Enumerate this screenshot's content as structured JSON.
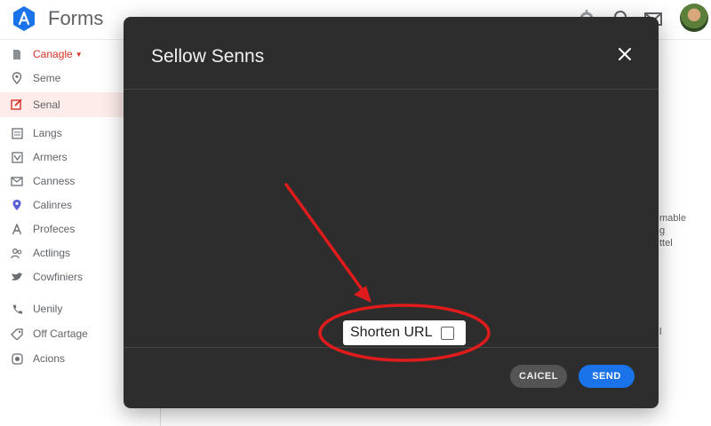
{
  "app": {
    "title": "Forms"
  },
  "header_icons": [
    "settings-icon",
    "search-icon",
    "mail-icon"
  ],
  "sidebar": {
    "items": [
      {
        "label": "Canagle",
        "icon": "document-icon"
      },
      {
        "label": "Seme",
        "icon": "location-pin-icon"
      },
      {
        "label": "Senal",
        "icon": "edit-icon"
      },
      {
        "label": "Langs",
        "icon": "list-icon"
      },
      {
        "label": "Armers",
        "icon": "image-icon"
      },
      {
        "label": "Canness",
        "icon": "mail-icon"
      },
      {
        "label": "Calinres",
        "icon": "location-pin-icon"
      },
      {
        "label": "Profeces",
        "icon": "font-icon"
      },
      {
        "label": "Actlings",
        "icon": "people-icon"
      },
      {
        "label": "Cowfiniers",
        "icon": "bird-icon"
      },
      {
        "label": "Uenily",
        "icon": "phone-icon"
      },
      {
        "label": "Off Cartage",
        "icon": "tag-icon"
      },
      {
        "label": "Acions",
        "icon": "app-icon"
      }
    ]
  },
  "background_fragments": [
    "mable",
    "g",
    "ttel",
    "l"
  ],
  "modal": {
    "title": "Sellow Senns",
    "shorten_label": "Shorten URL",
    "shorten_checked": false,
    "cancel_label": "CAICEL",
    "send_label": "SEND"
  },
  "colors": {
    "accent": "#1a73e8",
    "annotation": "#e01b1b",
    "modal_bg": "#2d2d2d",
    "active_item_bg": "#fdecea"
  }
}
